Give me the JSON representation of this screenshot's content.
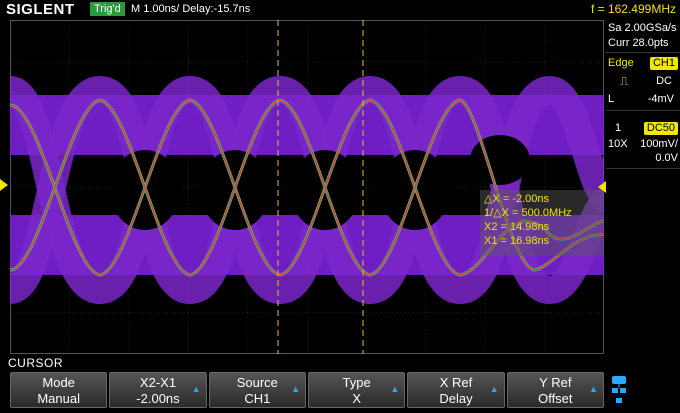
{
  "header": {
    "logo": "SIGLENT",
    "trigger_status": "Trig'd",
    "timebase": "M 1.00ns/  Delay:-15.7ns",
    "frequency": "f = 162.499MHz"
  },
  "acquisition": {
    "sample_rate": "Sa 2.00GSa/s",
    "memory": "Curr 28.0pts"
  },
  "trigger": {
    "type_label": "Edge",
    "source": "CH1",
    "slope_icon": "rising-edge-icon",
    "coupling": "DC",
    "level_label": "L",
    "level": "-4mV"
  },
  "channel1": {
    "number": "1",
    "coupling": "DC50",
    "probe": "10X",
    "scale": "100mV/",
    "offset": "0.0V",
    "color": "#f3e600"
  },
  "cursor_readout": {
    "delta_x": "△X = -2.00ns",
    "inv_delta_x": "1/△X = 500.0MHz",
    "x2": "X2 = 14.98ns",
    "x1": "X1 = 16.98ns"
  },
  "menu": {
    "title": "CURSOR",
    "buttons": [
      {
        "label": "Mode",
        "value": "Manual",
        "arrow": false
      },
      {
        "label": "X2-X1",
        "value": "-2.00ns",
        "arrow": true
      },
      {
        "label": "Source",
        "value": "CH1",
        "arrow": true
      },
      {
        "label": "Type",
        "value": "X",
        "arrow": true
      },
      {
        "label": "X Ref",
        "value": "Delay",
        "arrow": true
      },
      {
        "label": "Y Ref",
        "value": "Offset",
        "arrow": true
      }
    ]
  },
  "colors": {
    "trace_mid": "#8a2be2",
    "trace_hot": "#ff2a1a",
    "trace_cool": "#20d0a0",
    "cursor_line": "#e8c020",
    "accent": "#f3e600"
  }
}
